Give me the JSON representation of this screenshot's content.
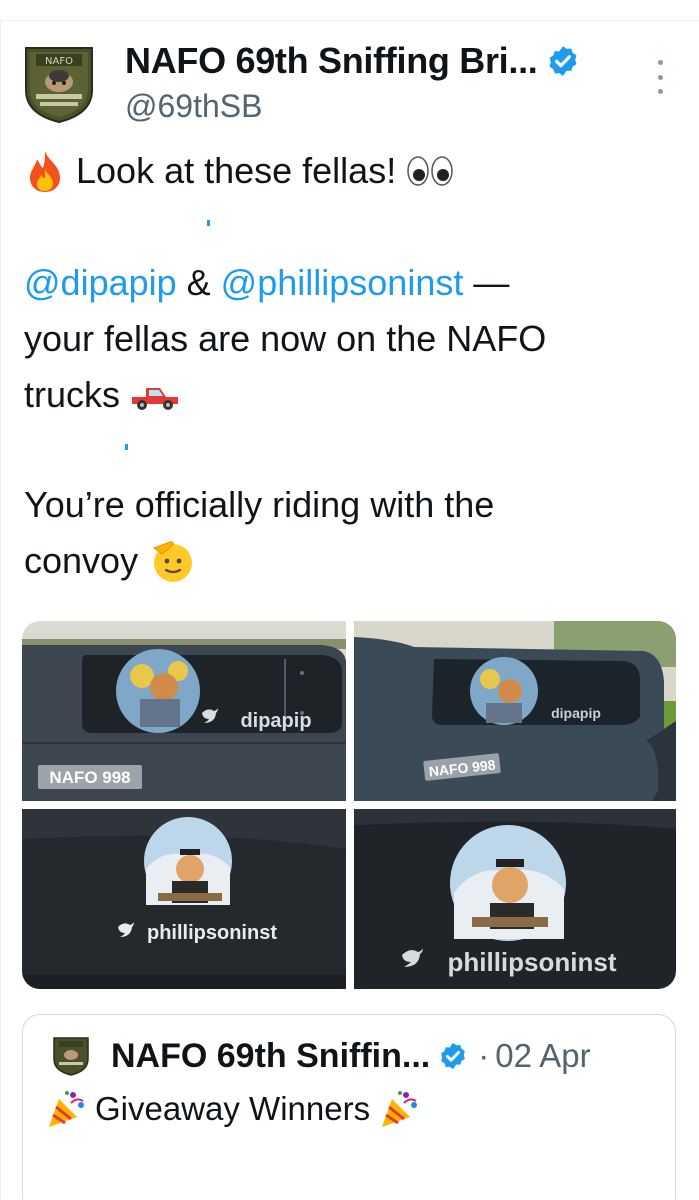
{
  "tweet": {
    "author": {
      "display_name": "NAFO 69th Sniffing Bri...",
      "handle": "@69thSB",
      "verified": true,
      "avatar_badge_text": "NAFO"
    },
    "more_icon": "more-vertical-icon",
    "line1_text": "Look at these fellas!",
    "mention1": "@dipapip",
    "amp": "&",
    "mention2": "@phillipsoninst",
    "dash": "—",
    "line3": "your fellas are now on the NAFO",
    "line4": "trucks",
    "line5": "You’re officially riding with the",
    "line6": "convoy"
  },
  "media": [
    {
      "plate": "NAFO 998",
      "handle_label": "dipapip"
    },
    {
      "plate": "NAFO 998",
      "handle_label": "dipapip"
    },
    {
      "handle_label": "phillipsoninst"
    },
    {
      "handle_label": "phillipsoninst"
    }
  ],
  "quoted_tweet": {
    "display_name": "NAFO 69th Sniffin...",
    "verified": true,
    "separator": "·",
    "date": "02 Apr",
    "text": "Giveaway Winners"
  },
  "colors": {
    "link": "#1d9bf0",
    "secondary_text": "#536471",
    "border": "#cfd9de",
    "verified": "#1d9bf0"
  }
}
